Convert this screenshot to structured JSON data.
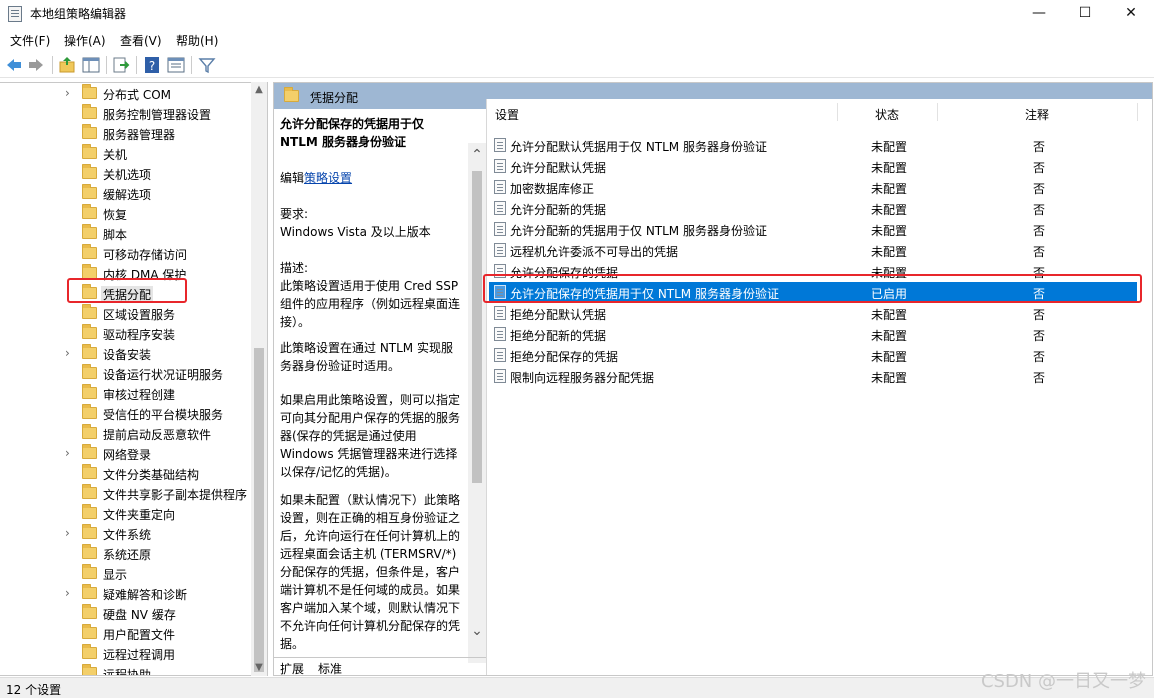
{
  "window": {
    "title": "本地组策略编辑器",
    "min_icon": "minimize-icon",
    "max_icon": "maximize-icon",
    "close_icon": "close-icon"
  },
  "menu": [
    "文件(F)",
    "操作(A)",
    "查看(V)",
    "帮助(H)"
  ],
  "toolbar_icons": [
    "back-arrow-icon",
    "forward-arrow-icon",
    "up-folder-icon",
    "show-hide-tree-icon",
    "export-list-icon",
    "help-icon",
    "properties-icon",
    "filter-icon"
  ],
  "tree": {
    "items": [
      {
        "label": "分布式 COM",
        "exp": "›"
      },
      {
        "label": "服务控制管理器设置",
        "exp": ""
      },
      {
        "label": "服务器管理器",
        "exp": ""
      },
      {
        "label": "关机",
        "exp": ""
      },
      {
        "label": "关机选项",
        "exp": ""
      },
      {
        "label": "缓解选项",
        "exp": ""
      },
      {
        "label": "恢复",
        "exp": ""
      },
      {
        "label": "脚本",
        "exp": ""
      },
      {
        "label": "可移动存储访问",
        "exp": ""
      },
      {
        "label": "内核 DMA 保护",
        "exp": ""
      },
      {
        "label": "凭据分配",
        "exp": ""
      },
      {
        "label": "区域设置服务",
        "exp": ""
      },
      {
        "label": "驱动程序安装",
        "exp": ""
      },
      {
        "label": "设备安装",
        "exp": "›"
      },
      {
        "label": "设备运行状况证明服务",
        "exp": ""
      },
      {
        "label": "审核过程创建",
        "exp": ""
      },
      {
        "label": "受信任的平台模块服务",
        "exp": ""
      },
      {
        "label": "提前启动反恶意软件",
        "exp": ""
      },
      {
        "label": "网络登录",
        "exp": "›"
      },
      {
        "label": "文件分类基础结构",
        "exp": ""
      },
      {
        "label": "文件共享影子副本提供程序",
        "exp": ""
      },
      {
        "label": "文件夹重定向",
        "exp": ""
      },
      {
        "label": "文件系统",
        "exp": "›"
      },
      {
        "label": "系统还原",
        "exp": ""
      },
      {
        "label": "显示",
        "exp": ""
      },
      {
        "label": "疑难解答和诊断",
        "exp": "›"
      },
      {
        "label": "硬盘 NV 缓存",
        "exp": ""
      },
      {
        "label": "用户配置文件",
        "exp": ""
      },
      {
        "label": "远程过程调用",
        "exp": ""
      },
      {
        "label": "远程协助",
        "exp": ""
      }
    ]
  },
  "header": {
    "folder_name": "凭据分配"
  },
  "description": {
    "title": "允许分配保存的凭据用于仅 NTLM 服务器身份验证",
    "edit_prefix": "编辑",
    "edit_link": "策略设置",
    "requirement_label": "要求:",
    "requirement_value": "Windows Vista 及以上版本",
    "desc_label": "描述:",
    "p1": "此策略设置适用于使用 Cred SSP 组件的应用程序（例如远程桌面连接）。",
    "p2": "此策略设置在通过 NTLM 实现服务器身份验证时适用。",
    "p3": "如果启用此策略设置，则可以指定可向其分配用户保存的凭据的服务器(保存的凭据是通过使用 Windows 凭据管理器来进行选择以保存/记忆的凭据)。",
    "p4": "如果未配置（默认情况下）此策略设置，则在正确的相互身份验证之后，允许向运行在任何计算机上的远程桌面会话主机 (TERMSRV/*) 分配保存的凭据，但条件是，客户端计算机不是任何域的成员。如果客户端加入某个域，则默认情况下不允许向任何计算机分配保存的凭据。"
  },
  "tabs": [
    "扩展",
    "标准"
  ],
  "list": {
    "columns": [
      "设置",
      "状态",
      "注释"
    ],
    "rows": [
      {
        "name": "允许分配默认凭据用于仅 NTLM 服务器身份验证",
        "state": "未配置",
        "note": "否"
      },
      {
        "name": "允许分配默认凭据",
        "state": "未配置",
        "note": "否"
      },
      {
        "name": "加密数据库修正",
        "state": "未配置",
        "note": "否"
      },
      {
        "name": "允许分配新的凭据",
        "state": "未配置",
        "note": "否"
      },
      {
        "name": "允许分配新的凭据用于仅 NTLM 服务器身份验证",
        "state": "未配置",
        "note": "否"
      },
      {
        "name": "远程机允许委派不可导出的凭据",
        "state": "未配置",
        "note": "否"
      },
      {
        "name": "允许分配保存的凭据",
        "state": "未配置",
        "note": "否"
      },
      {
        "name": "允许分配保存的凭据用于仅 NTLM 服务器身份验证",
        "state": "已启用",
        "note": "否"
      },
      {
        "name": "拒绝分配默认凭据",
        "state": "未配置",
        "note": "否"
      },
      {
        "name": "拒绝分配新的凭据",
        "state": "未配置",
        "note": "否"
      },
      {
        "name": "拒绝分配保存的凭据",
        "state": "未配置",
        "note": "否"
      },
      {
        "name": "限制向远程服务器分配凭据",
        "state": "未配置",
        "note": "否"
      }
    ]
  },
  "status": {
    "text": "12 个设置"
  },
  "watermark": "CSDN @一日又一梦",
  "colors": {
    "selection": "#0078d7",
    "header_band": "#9eb7d3",
    "highlight_box": "#e8262b"
  }
}
